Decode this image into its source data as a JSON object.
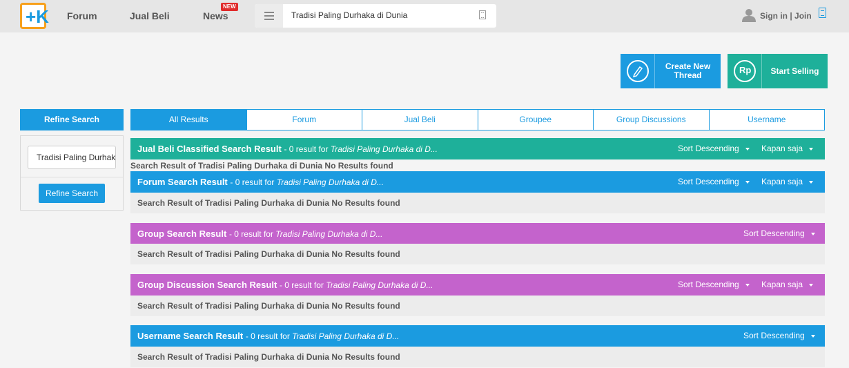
{
  "header": {
    "nav": [
      "Forum",
      "Jual Beli",
      "News"
    ],
    "new_badge": "NEW",
    "search_value": "Tradisi Paling Durhaka di Dunia",
    "signin": "Sign in | Join"
  },
  "actions": {
    "create_thread": "Create New Thread",
    "start_selling": "Start Selling",
    "rp_symbol": "Rp"
  },
  "refine": {
    "title": "Refine Search",
    "input_value": "Tradisi Paling Durhaka di Dunia",
    "button": "Refine Search"
  },
  "tabs": [
    "All Results",
    "Forum",
    "Jual Beli",
    "Groupee",
    "Group Discussions",
    "Username"
  ],
  "results": [
    {
      "title": "Jual Beli Classified Search Result",
      "count": "- 0 result for ",
      "query": "Tradisi Paling Durhaka di D...",
      "sort": "Sort Descending",
      "time": "Kapan saja",
      "body": "Search Result of Tradisi Paling Durhaka di Dunia No Results found"
    },
    {
      "title": "Forum Search Result",
      "count": "- 0 result for ",
      "query": "Tradisi Paling Durhaka di D...",
      "sort": "Sort Descending",
      "time": "Kapan saja",
      "body": "Search Result of Tradisi Paling Durhaka di Dunia No Results found"
    },
    {
      "title": "Group Search Result",
      "count": "- 0 result for ",
      "query": "Tradisi Paling Durhaka di D...",
      "sort": "Sort Descending",
      "body": "Search Result of Tradisi Paling Durhaka di Dunia No Results found"
    },
    {
      "title": "Group Discussion Search Result",
      "count": "- 0 result for ",
      "query": "Tradisi Paling Durhaka di D...",
      "sort": "Sort Descending",
      "time": "Kapan saja",
      "body": "Search Result of Tradisi Paling Durhaka di Dunia No Results found"
    },
    {
      "title": "Username Search Result",
      "count": "- 0 result for ",
      "query": "Tradisi Paling Durhaka di D...",
      "sort": "Sort Descending",
      "body": "Search Result of Tradisi Paling Durhaka di Dunia No Results found"
    }
  ]
}
